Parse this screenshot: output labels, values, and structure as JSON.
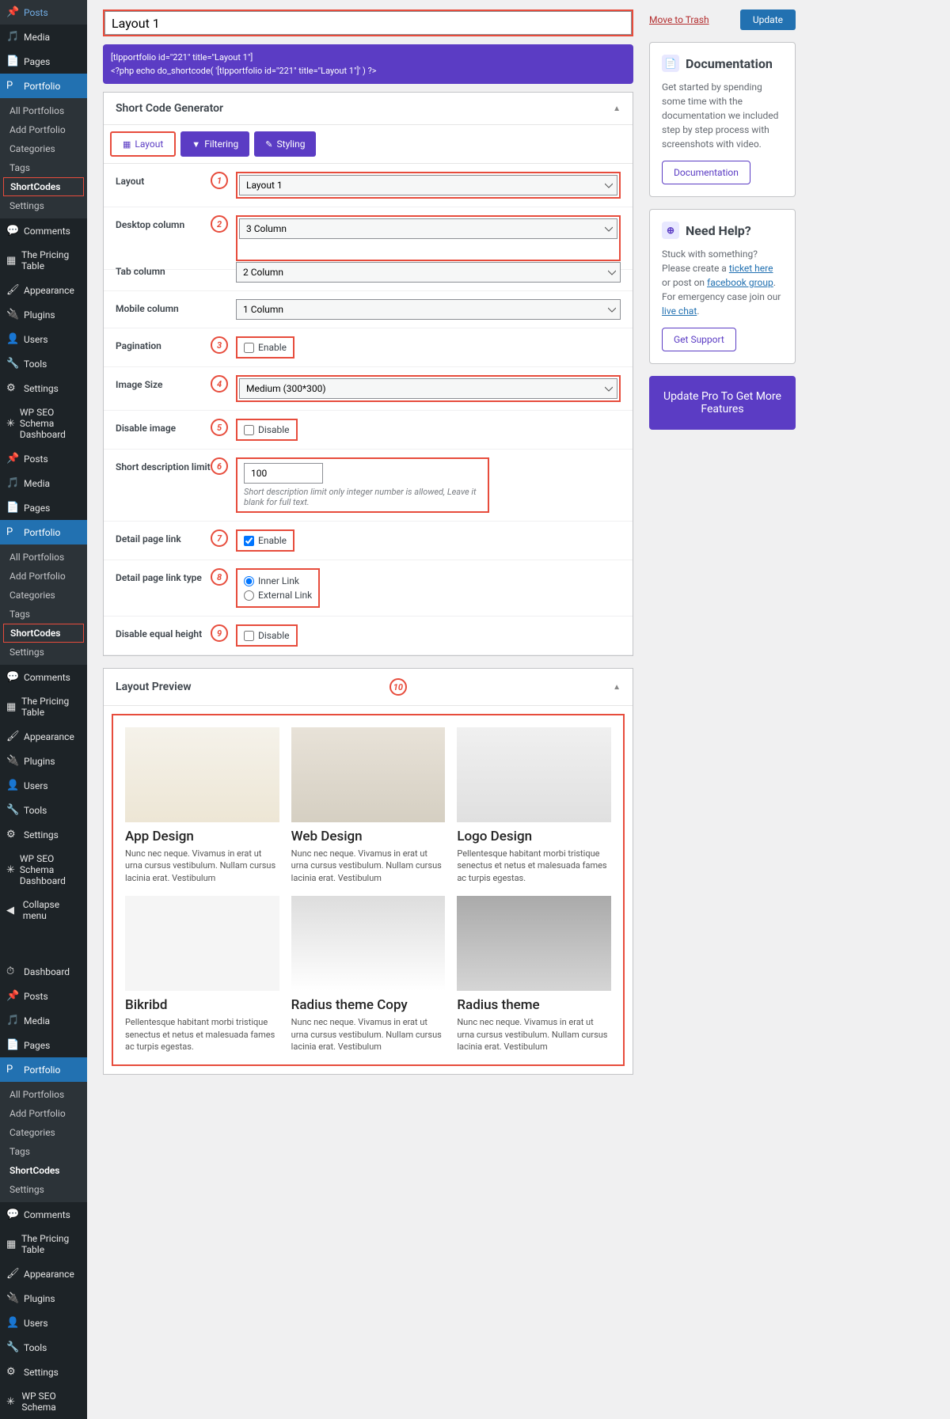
{
  "title_input": "Layout 1",
  "code_lines": {
    "a": "[tlpportfolio id=\"221\" title=\"Layout 1\"]",
    "b": "<?php echo do_shortcode( '[tlpportfolio id=\"221\" title=\"Layout 1\"]' ) ?>"
  },
  "panel1_title": "Short Code Generator",
  "tabs": {
    "layout": "Layout",
    "filtering": "Filtering",
    "styling": "Styling"
  },
  "form": {
    "layout_label": "Layout",
    "layout_value": "Layout 1",
    "desktop_label": "Desktop column",
    "desktop_value": "3 Column",
    "tab_label": "Tab column",
    "tab_value": "2 Column",
    "mobile_label": "Mobile column",
    "mobile_value": "1 Column",
    "pagination_label": "Pagination",
    "pagination_cb": "Enable",
    "imagesize_label": "Image Size",
    "imagesize_value": "Medium (300*300)",
    "disableimg_label": "Disable image",
    "disableimg_cb": "Disable",
    "shortdesc_label": "Short description limit",
    "shortdesc_value": "100",
    "shortdesc_help": "Short description limit only integer number is allowed, Leave it blank for full text.",
    "detaillink_label": "Detail page link",
    "detaillink_cb": "Enable",
    "linktype_label": "Detail page link type",
    "linktype_inner": "Inner Link",
    "linktype_ext": "External Link",
    "equalheight_label": "Disable equal height",
    "equalheight_cb": "Disable"
  },
  "markers": {
    "m1": "1",
    "m2": "2",
    "m3": "3",
    "m4": "4",
    "m5": "5",
    "m6": "6",
    "m7": "7",
    "m8": "8",
    "m9": "9",
    "m10": "10"
  },
  "preview_title": "Layout Preview",
  "preview_items": {
    "i1": {
      "title": "App Design",
      "desc": "Nunc nec neque. Vivamus in erat ut urna cursus vestibulum. Nullam cursus lacinia erat. Vestibulum"
    },
    "i2": {
      "title": "Web Design",
      "desc": "Nunc nec neque. Vivamus in erat ut urna cursus vestibulum. Nullam cursus lacinia erat. Vestibulum"
    },
    "i3": {
      "title": "Logo Design",
      "desc": "Pellentesque habitant morbi tristique senectus et netus et malesuada fames ac turpis egestas."
    },
    "i4": {
      "title": "Bikribd",
      "desc": "Pellentesque habitant morbi tristique senectus et netus et malesuada fames ac turpis egestas."
    },
    "i5": {
      "title": "Radius theme Copy",
      "desc": "Nunc nec neque. Vivamus in erat ut urna cursus vestibulum. Nullam cursus lacinia erat. Vestibulum"
    },
    "i6": {
      "title": "Radius theme",
      "desc": "Nunc nec neque. Vivamus in erat ut urna cursus vestibulum. Nullam cursus lacinia erat. Vestibulum"
    }
  },
  "publish": {
    "trash": "Move to Trash",
    "update": "Update"
  },
  "doc": {
    "title": "Documentation",
    "text": "Get started by spending some time with the documentation we included step by step process with screenshots with video.",
    "btn": "Documentation"
  },
  "help": {
    "title": "Need Help?",
    "text1": "Stuck with something? Please create a ",
    "link1": "ticket here",
    "text2": " or post on ",
    "link2": "facebook group",
    "text3": ". For emergency case join our ",
    "link3": "live chat",
    "text4": ".",
    "btn": "Get Support"
  },
  "pro": "Update Pro To Get More Features",
  "sidebar": {
    "posts": "Posts",
    "media": "Media",
    "pages": "Pages",
    "portfolio": "Portfolio",
    "all_portfolios": "All Portfolios",
    "add_portfolio": "Add Portfolio",
    "categories": "Categories",
    "tags": "Tags",
    "shortcodes": "ShortCodes",
    "settings": "Settings",
    "comments": "Comments",
    "pricing": "The Pricing Table",
    "appearance": "Appearance",
    "plugins": "Plugins",
    "users": "Users",
    "tools": "Tools",
    "settings2": "Settings",
    "seo": "WP SEO Schema Dashboard",
    "collapse": "Collapse menu",
    "dashboard": "Dashboard",
    "seo2": "WP SEO Schema"
  }
}
